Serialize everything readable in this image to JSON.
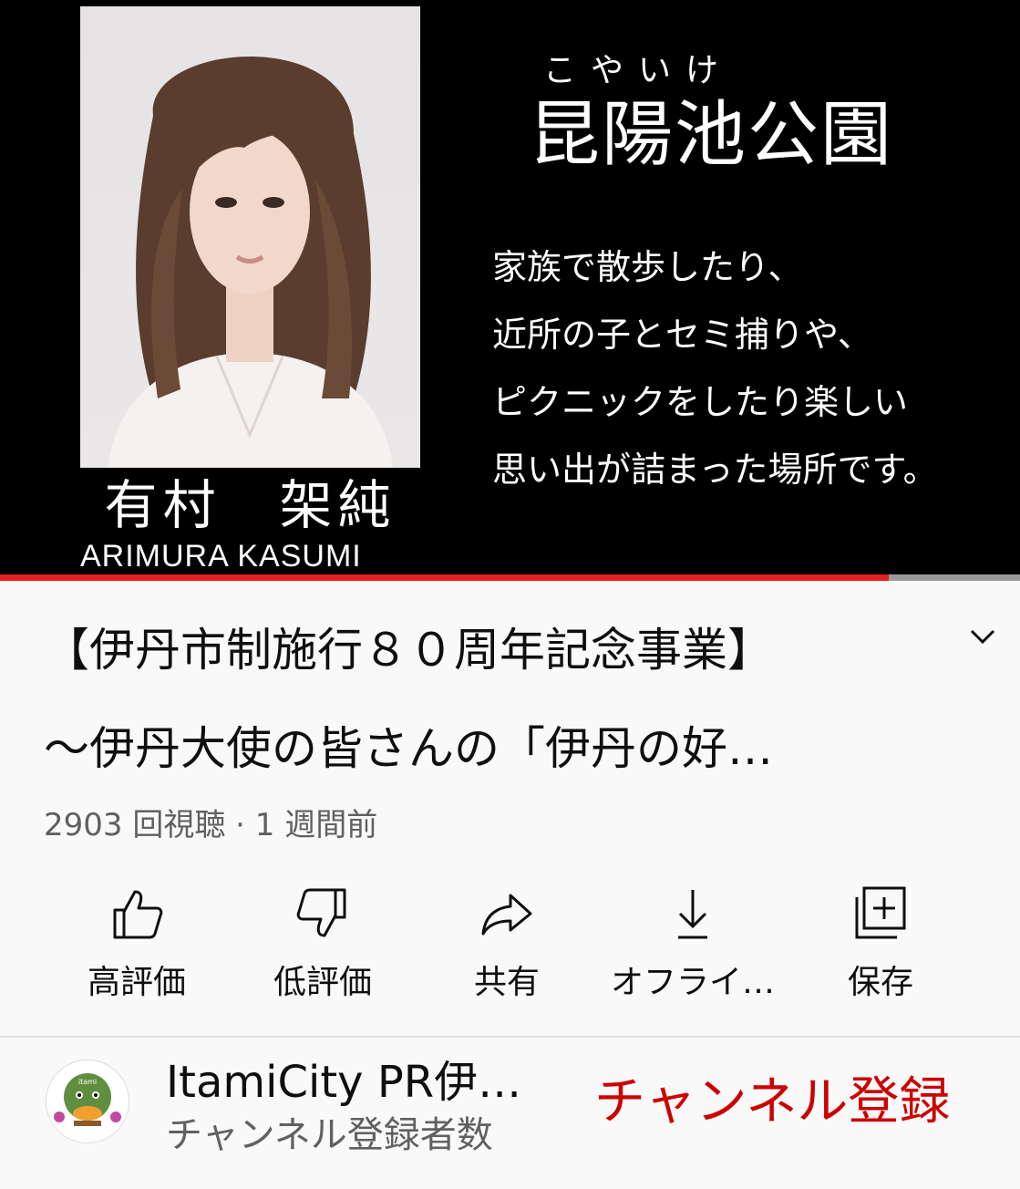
{
  "video": {
    "person_name_jp": "有村　架純",
    "person_name_en": "ARIMURA  KASUMI",
    "place_ruby": "こやいけ",
    "place_name": "昆陽池公園",
    "description_lines": [
      "家族で散歩したり、",
      "近所の子とセミ捕りや、",
      "ピクニックをしたり楽しい",
      "思い出が詰まった場所です。"
    ],
    "progress": 0.871
  },
  "details": {
    "title_line1": "【伊丹市制施行８０周年記念事業】",
    "title_line2": "〜伊丹大使の皆さんの「伊丹の好…",
    "meta": "2903 回視聴 · 1 週間前"
  },
  "actions": [
    {
      "label": "高評価",
      "icon": "thumbs-up-icon"
    },
    {
      "label": "低評価",
      "icon": "thumbs-down-icon"
    },
    {
      "label": "共有",
      "icon": "share-icon"
    },
    {
      "label": "オフライ…",
      "icon": "download-icon"
    },
    {
      "label": "保存",
      "icon": "save-playlist-icon"
    }
  ],
  "channel": {
    "name": "ItamiCity PR伊…",
    "subscribers": "チャンネル登録者数",
    "subscribe_label": "チャンネル登録",
    "avatar_text": "itami"
  },
  "colors": {
    "accent": "#cc0000",
    "progress": "#e41e1e",
    "text_primary": "#0f0f0f",
    "text_secondary": "#606060"
  }
}
